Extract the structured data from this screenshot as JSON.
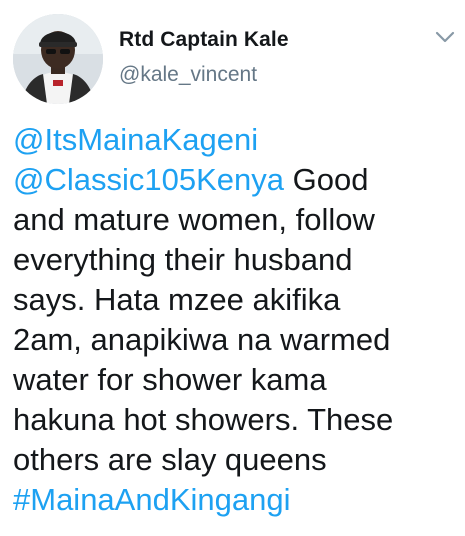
{
  "author": {
    "display_name": "Rtd Captain Kale",
    "handle": "@kale_vincent"
  },
  "icons": {
    "more": "chevron-down-icon",
    "avatar": "profile-photo"
  },
  "colors": {
    "link": "#1da1f2",
    "text": "#14171a",
    "secondary": "#657786"
  },
  "tweet": {
    "mention_1": "@ItsMainaKageni",
    "mention_2": "@Classic105Kenya",
    "text_1": " Good",
    "text_2": "and mature women, follow",
    "text_3": "everything their husband",
    "text_4": "says. Hata mzee akifika",
    "text_5": "2am, anapikiwa na warmed",
    "text_6": "water for shower kama",
    "text_7": "hakuna hot showers. These",
    "text_8": "others are slay queens",
    "hashtag": "#MainaAndKingangi"
  }
}
